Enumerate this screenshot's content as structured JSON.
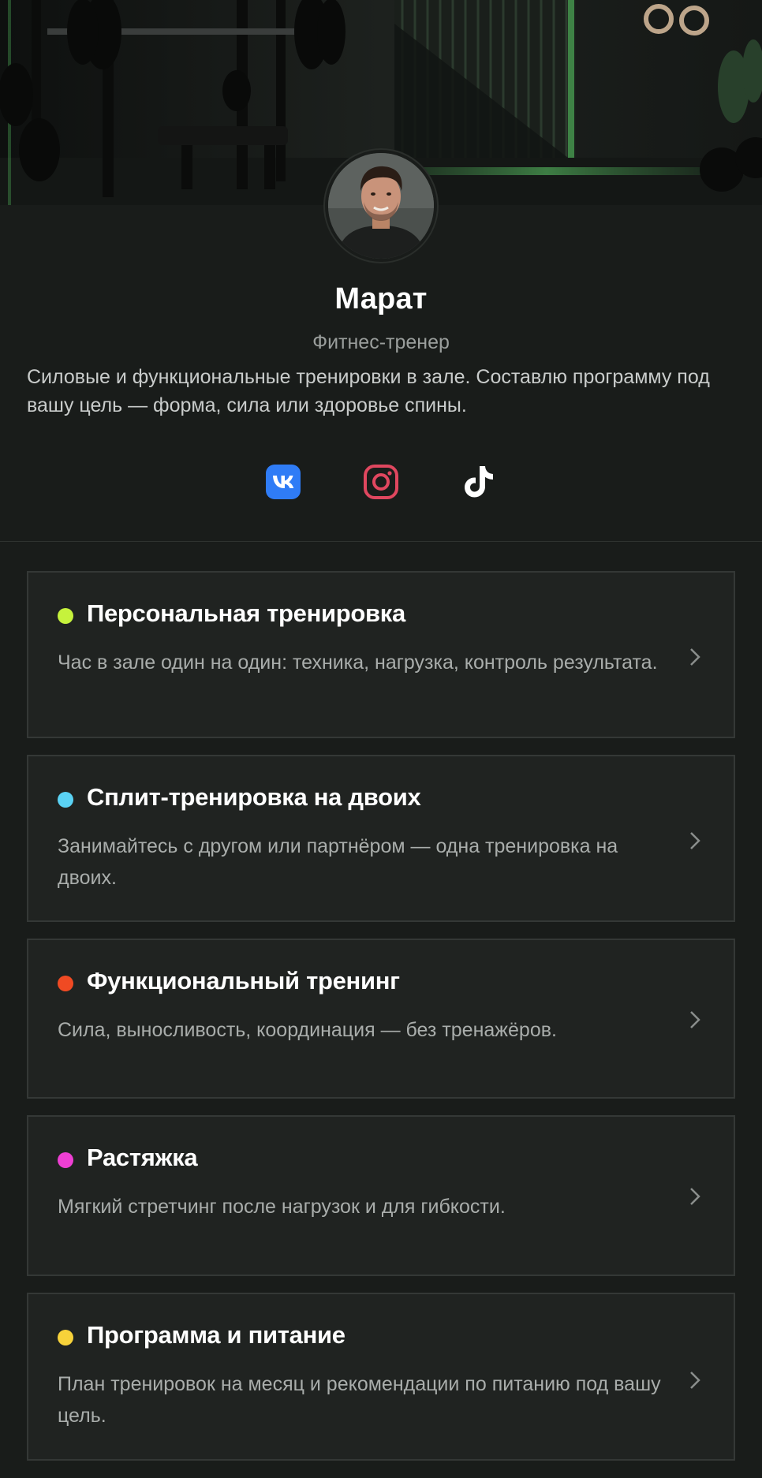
{
  "profile": {
    "name": "Марат",
    "role": "Фитнес-тренер",
    "bio": "Силовые и функциональные тренировки в зале. Составлю программу под вашу цель — форма, сила или здоровье спины."
  },
  "socials": [
    {
      "name": "vk-icon",
      "color": "#2f7cf6"
    },
    {
      "name": "instagram-icon",
      "color": "#e0475f"
    },
    {
      "name": "tiktok-icon",
      "color": "#ffffff"
    }
  ],
  "services": [
    {
      "title": "Персональная тренировка",
      "description": "Час в зале один на один: техника, нагрузка, контроль результата.",
      "dot_color": "#c6f23c"
    },
    {
      "title": "Сплит-тренировка на двоих",
      "description": "Занимайтесь с другом или партнёром — одна тренировка на двоих.",
      "dot_color": "#5ad2f4"
    },
    {
      "title": "Функциональный тренинг",
      "description": "Сила, выносливость, координация — без тренажёров.",
      "dot_color": "#f04a23"
    },
    {
      "title": "Растяжка",
      "description": "Мягкий стретчинг после нагрузок и для гибкости.",
      "dot_color": "#ee3fd3"
    },
    {
      "title": "Программа и питание",
      "description": "План тренировок на месяц и рекомендации по питанию под вашу цель.",
      "dot_color": "#f7d23a"
    }
  ]
}
